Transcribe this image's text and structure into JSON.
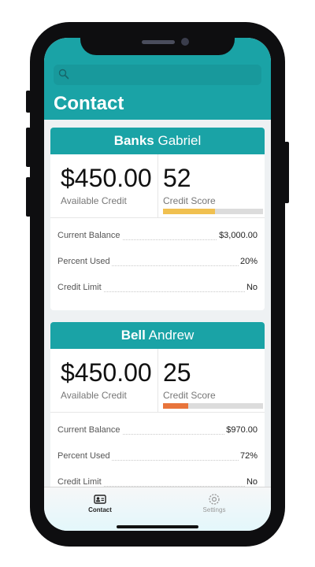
{
  "header": {
    "title": "Contact",
    "search_placeholder": ""
  },
  "contacts": [
    {
      "last_name": "Banks",
      "first_name": "Gabriel",
      "available_credit": "$450.00",
      "available_credit_label": "Available Credit",
      "credit_score": "52",
      "credit_score_label": "Credit Score",
      "score_fraction": 0.52,
      "score_color": "#f0c050",
      "rows": [
        {
          "label": "Current Balance",
          "value": "$3,000.00"
        },
        {
          "label": "Percent Used",
          "value": "20%"
        },
        {
          "label": "Credit Limit",
          "value": "No"
        }
      ]
    },
    {
      "last_name": "Bell",
      "first_name": "Andrew",
      "available_credit": "$450.00",
      "available_credit_label": "Available Credit",
      "credit_score": "25",
      "credit_score_label": "Credit Score",
      "score_fraction": 0.25,
      "score_color": "#e8743b",
      "rows": [
        {
          "label": "Current Balance",
          "value": "$970.00"
        },
        {
          "label": "Percent Used",
          "value": "72%"
        },
        {
          "label": "Credit Limit",
          "value": "No"
        }
      ]
    }
  ],
  "tabbar": {
    "contact_label": "Contact",
    "settings_label": "Settings",
    "contact_icon": "contact-card-icon",
    "settings_icon": "gear-icon"
  },
  "colors": {
    "accent": "#1aa3a6"
  }
}
